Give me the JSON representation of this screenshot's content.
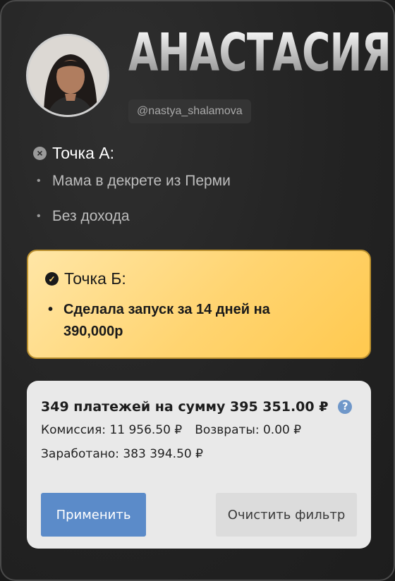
{
  "profile": {
    "name": "АНАСТАСИЯ",
    "handle": "@nastya_shalamova"
  },
  "point_a": {
    "title": "Точка А:",
    "items": [
      "Мама в декрете из Перми",
      "Без дохода"
    ]
  },
  "point_b": {
    "title": "Точка Б:",
    "items": [
      "Сделала запуск за 14 дней на 390,000р"
    ]
  },
  "stats": {
    "summary": "349 платежей на сумму 395 351.00 ₽",
    "commission": "Комиссия: 11 956.50 ₽",
    "refunds": "Возвраты: 0.00 ₽",
    "earned": "Заработано: 383 394.50 ₽",
    "apply_label": "Применить",
    "clear_label": "Очистить фильтр"
  },
  "colors": {
    "accent_gold": "#ffd470",
    "apply_blue": "#5b8bc9",
    "help_blue": "#6f97c9"
  },
  "icons": {
    "point_a": "x-circle-icon",
    "point_b": "check-circle-icon",
    "help": "question-circle-icon"
  }
}
